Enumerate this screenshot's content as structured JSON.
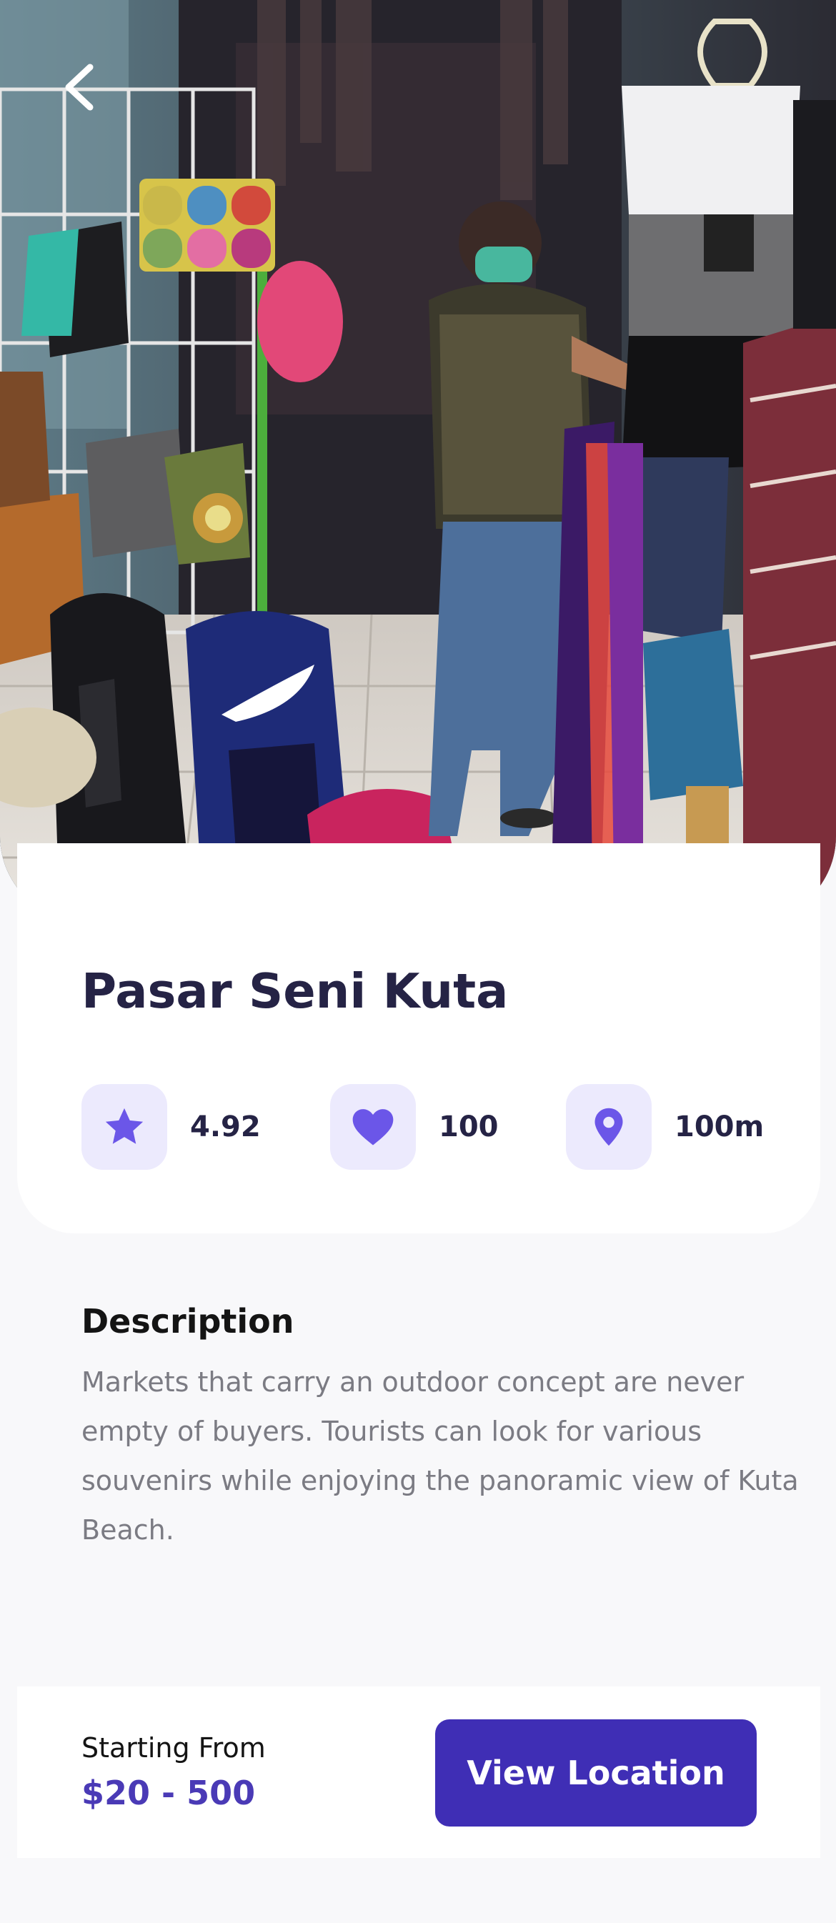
{
  "hero": {
    "photo_description_icon": "market-photo",
    "back_icon": "chevron-left-icon"
  },
  "place": {
    "title": "Pasar Seni Kuta"
  },
  "stats": {
    "rating": {
      "icon": "star-icon",
      "value": "4.92"
    },
    "likes": {
      "icon": "heart-icon",
      "value": "100"
    },
    "distance": {
      "icon": "location-pin-icon",
      "value": "100m"
    }
  },
  "description": {
    "heading": "Description",
    "text": "Markets that carry an outdoor concept are never empty of buyers. Tourists can look for various souvenirs while enjoying the panoramic view of Kuta Beach."
  },
  "pricing": {
    "label": "Starting From",
    "value": "$20 - 500"
  },
  "actions": {
    "view_location_label": "View Location"
  },
  "colors": {
    "accent": "#3F2EB5",
    "icon": "#6B56E8",
    "icon_bg": "#ECEAFD",
    "title": "#252345",
    "muted_text": "#7B7B83",
    "page_bg": "#F8F8FA"
  }
}
